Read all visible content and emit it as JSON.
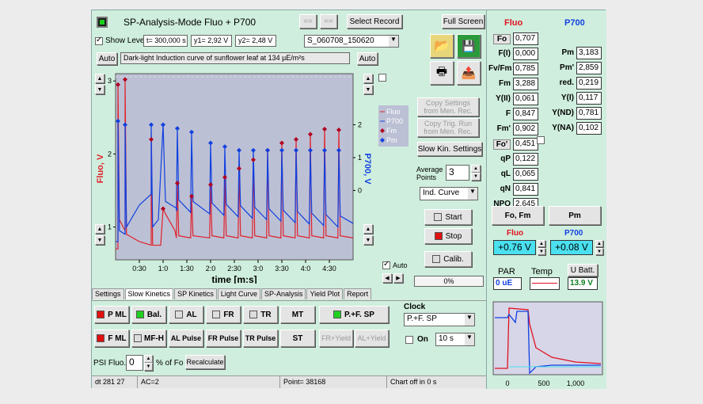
{
  "header": {
    "title": "SP-Analysis-Mode   Fluo + P700",
    "arrow_left": "==",
    "arrow_right": "==",
    "select_record": "Select Record",
    "full_screen": "Full Screen"
  },
  "toolbar": {
    "show_level": "Show Level",
    "t": "t= 300,000 s",
    "y1": "y1= 2,92 V",
    "y2": "y2= 2,48 V",
    "record": "S_060708_150620",
    "auto_left": "Auto",
    "auto_right": "Auto",
    "caption": "Dark-light Induction curve of sunflower leaf at 134 µE/m²s"
  },
  "chart_data": {
    "type": "line",
    "xlabel": "time [m:s]",
    "ylabel_left": "Fluo, V",
    "ylabel_right": "P700, V",
    "x_ticks": [
      "0:30",
      "1:0",
      "1:30",
      "2:0",
      "2:30",
      "3:0",
      "3:30",
      "4:0",
      "4:30"
    ],
    "y_left_ticks": [
      "3",
      "2",
      "1"
    ],
    "y_right_ticks": [
      "2",
      "1",
      "0"
    ],
    "legend": [
      "Fluo",
      "P700",
      "Fm",
      "Pm"
    ],
    "colors": {
      "fluo": "#e0202a",
      "p700": "#1040e0"
    },
    "fm_points": [
      [
        0.05,
        2.95
      ],
      [
        0.2,
        3.02
      ],
      [
        0.75,
        2.2
      ],
      [
        1.0,
        1.25
      ],
      [
        1.3,
        1.6
      ],
      [
        1.6,
        1.42
      ],
      [
        2.0,
        1.58
      ],
      [
        2.3,
        1.68
      ],
      [
        2.6,
        1.8
      ],
      [
        2.9,
        1.92
      ],
      [
        3.2,
        2.05
      ],
      [
        3.5,
        2.15
      ],
      [
        3.8,
        2.2
      ],
      [
        4.1,
        2.27
      ],
      [
        4.4,
        2.34
      ],
      [
        4.7,
        2.33
      ]
    ],
    "pm_points": [
      [
        0.05,
        2.45
      ],
      [
        0.2,
        2.4
      ],
      [
        0.75,
        2.4
      ],
      [
        1.0,
        2.4
      ],
      [
        1.3,
        2.35
      ],
      [
        1.6,
        2.3
      ],
      [
        2.0,
        2.15
      ],
      [
        2.3,
        2.1
      ],
      [
        2.6,
        2.05
      ],
      [
        2.9,
        2.05
      ],
      [
        3.2,
        2.05
      ],
      [
        3.5,
        2.05
      ],
      [
        3.8,
        2.05
      ],
      [
        4.1,
        2.05
      ],
      [
        4.4,
        2.05
      ],
      [
        4.7,
        2.05
      ]
    ],
    "average_points_label": "Average Points",
    "average_points": "3",
    "auto_label": "Auto"
  },
  "side_controls": {
    "copy_settings": "Copy Settings from Men. Rec.",
    "copy_trig": "Copy Trig. Run from Men. Rec.",
    "slow_kin": "Slow Kin. Settings",
    "curve": "Ind. Curve",
    "start": "Start",
    "stop": "Stop",
    "calib": "Calib.",
    "progress": "0%"
  },
  "tabs": [
    "Settings",
    "Slow Kinetics",
    "SP Kinetics",
    "Light Curve",
    "SP-Analysis",
    "Yield Plot",
    "Report"
  ],
  "bottom": {
    "p_ml": "P ML",
    "f_ml": "F ML",
    "bal": "Bal.",
    "mf_h": "MF-H",
    "al": "AL",
    "fr": "FR",
    "tr": "TR",
    "mt": "MT",
    "pf_sp": "P.+F. SP",
    "al_pulse": "AL Pulse",
    "fr_pulse": "FR Pulse",
    "tr_pulse": "TR Pulse",
    "st": "ST",
    "fr_yield": "FR+Yield",
    "al_yield": "AL+Yield",
    "clock": "Clock",
    "clock_mode": "P.+F. SP",
    "on": "On",
    "interval": "10 s",
    "psi_label": "PSI Fluo.",
    "psi_value": "0",
    "psi_unit": "% of Fo",
    "recalc": "Recalculate"
  },
  "status": [
    "dt 281 27",
    "AC=2",
    "Point= 38168",
    "Chart off in 0 s"
  ],
  "fluo_panel": {
    "title": "Fluo",
    "rows": [
      {
        "label": "Fo",
        "value": "0,707"
      },
      {
        "label": "F(I)",
        "value": "0,000"
      },
      {
        "label": "Fv/Fm",
        "value": "0,785"
      },
      {
        "label": "Fm",
        "value": "3,288"
      },
      {
        "label": "Y(II)",
        "value": "0,061"
      },
      {
        "label": "F",
        "value": "0,847"
      },
      {
        "label": "Fm'",
        "value": "0,902"
      },
      {
        "label": "Fo'",
        "value": "0,451"
      },
      {
        "label": "qP",
        "value": "0,122"
      },
      {
        "label": "qL",
        "value": "0,065"
      },
      {
        "label": "qN",
        "value": "0,841"
      },
      {
        "label": "NPQ",
        "value": "2,645"
      }
    ],
    "btn": "Fo, Fm",
    "level_label": "Fluo",
    "level": "+0.76 V"
  },
  "p700_panel": {
    "title": "P700",
    "rows": [
      {
        "label": "Pm",
        "value": "3,183"
      },
      {
        "label": "Pm'",
        "value": "2,859"
      },
      {
        "label": "red.",
        "value": "0,219"
      },
      {
        "label": "Y(I)",
        "value": "0,117"
      },
      {
        "label": "Y(ND)",
        "value": "0,781"
      },
      {
        "label": "Y(NA)",
        "value": "0,102"
      }
    ],
    "btn": "Pm",
    "level_label": "P700",
    "level": "+0.08 V"
  },
  "env": {
    "par_label": "PAR",
    "par": "0 uE",
    "temp_label": "Temp",
    "batt_label": "U Batt.",
    "batt": "13.9 V"
  },
  "mini_chart": {
    "x_ticks": [
      "0",
      "500",
      "1,000"
    ]
  }
}
